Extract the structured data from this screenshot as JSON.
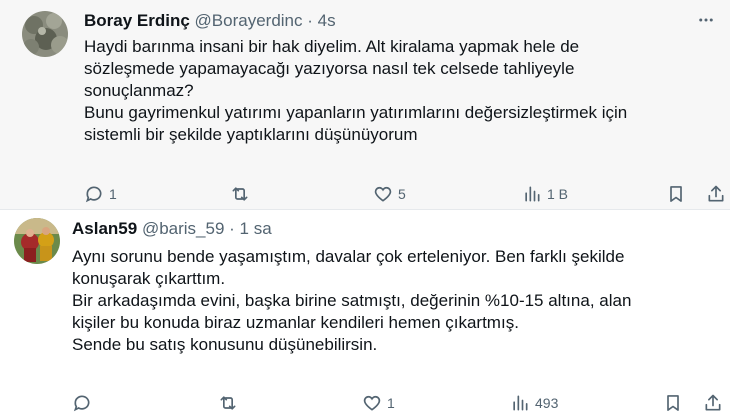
{
  "tweets": [
    {
      "author": {
        "name": "Boray Erdinç",
        "handle": "@Borayerdinc",
        "separator": "·",
        "time": "4s"
      },
      "text": "Haydi barınma insani bir hak diyelim. Alt kiralama yapmak hele de\nsözleşmede yapamayacağı yazıyorsa nasıl tek celsede tahliyeyle\nsonuçlanmaz?\nBunu gayrimenkul yatırımı yapanların yatırımlarını değersizleştirmek için\nsistemli bir şekilde yaptıklarını düşünüyorum",
      "stats": {
        "replies": "1",
        "reposts": "",
        "likes": "5",
        "views": "1 B"
      },
      "icons": [
        "reply-icon",
        "repost-icon",
        "like-icon",
        "views-icon",
        "bookmark-icon",
        "share-icon",
        "more-icon"
      ]
    },
    {
      "author": {
        "name": "Aslan59",
        "handle": "@baris_59",
        "separator": "·",
        "time": "1 sa"
      },
      "text": "Aynı sorunu bende yaşamıştım, davalar çok erteleniyor. Ben farklı şekilde\nkonuşarak çıkarttım.\nBir arkadaşımda evini, başka birine satmıştı, değerinin %10-15 altına, alan\nkişiler bu konuda biraz uzmanlar kendileri hemen çıkartmış.\nSende bu satış konusunu düşünebilirsin.",
      "stats": {
        "replies": "",
        "reposts": "",
        "likes": "1",
        "views": "493"
      },
      "icons": [
        "reply-icon",
        "repost-icon",
        "like-icon",
        "views-icon",
        "bookmark-icon",
        "share-icon"
      ]
    }
  ],
  "colors": {
    "text": "#0f1419",
    "muted": "#536471",
    "highlight_bg": "#f7f7f7"
  }
}
